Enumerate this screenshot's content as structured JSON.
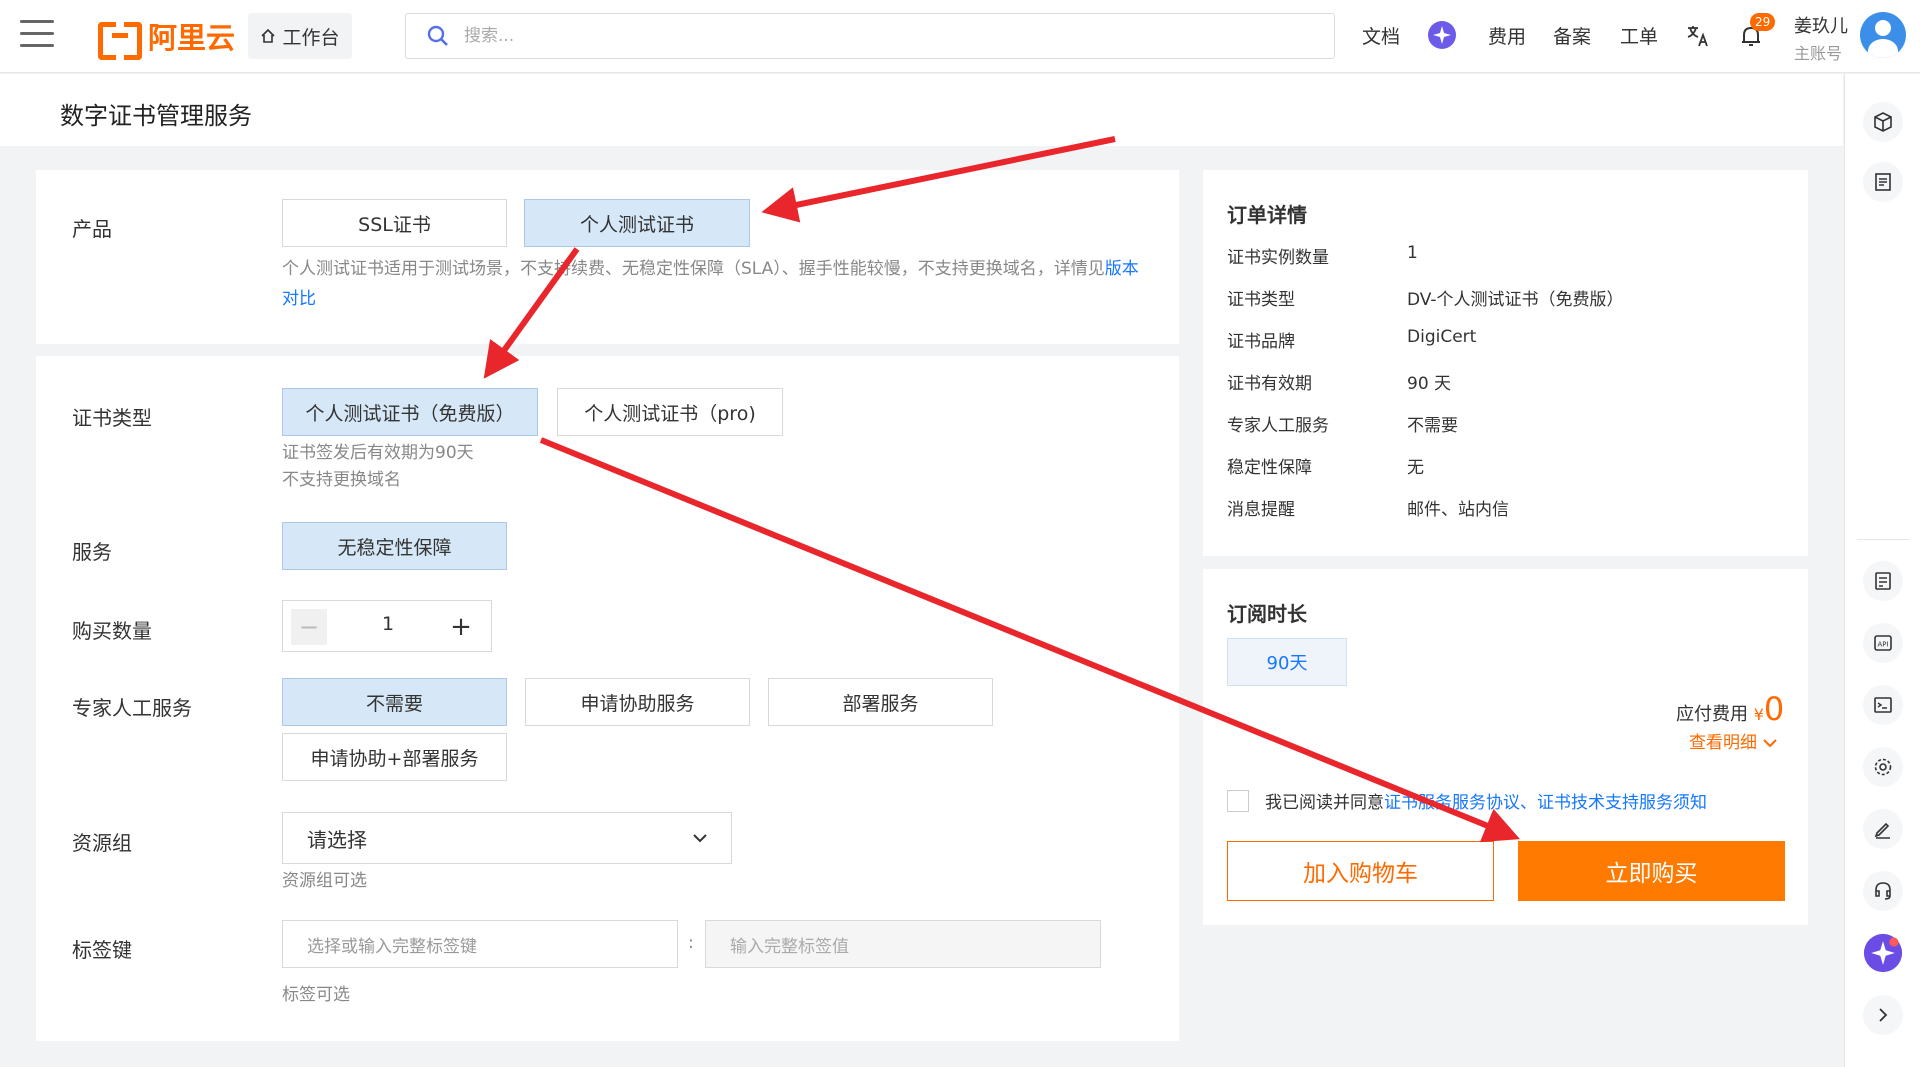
{
  "topbar": {
    "workbench": "工作台",
    "search_placeholder": "搜索...",
    "nav": [
      "文档",
      "费用",
      "备案",
      "工单"
    ],
    "notification_count": "29",
    "user_name": "姜玖儿",
    "user_role": "主账号"
  },
  "page_title": "数字证书管理服务",
  "product": {
    "label": "产品",
    "options": [
      "SSL证书",
      "个人测试证书"
    ],
    "selected": "个人测试证书",
    "hint_text": "个人测试证书适用于测试场景，不支持续费、无稳定性保障（SLA）、握手性能较慢，不支持更换域名，详情见",
    "hint_link": "版本对比"
  },
  "cert_type": {
    "label": "证书类型",
    "options": [
      "个人测试证书（免费版）",
      "个人测试证书（pro)"
    ],
    "selected": "个人测试证书（免费版）",
    "hint_line1": "证书签发后有效期为90天",
    "hint_line2": "不支持更换域名"
  },
  "service": {
    "label": "服务",
    "option": "无稳定性保障"
  },
  "quantity": {
    "label": "购买数量",
    "value": "1",
    "minus": "−",
    "plus": "+"
  },
  "expert": {
    "label": "专家人工服务",
    "options": [
      "不需要",
      "申请协助服务",
      "部署服务",
      "申请协助+部署服务"
    ],
    "selected": "不需要"
  },
  "resource_group": {
    "label": "资源组",
    "placeholder": "请选择",
    "hint": "资源组可选"
  },
  "tag": {
    "label": "标签键",
    "key_placeholder": "选择或输入完整标签键",
    "separator": ":",
    "value_placeholder": "输入完整标签值",
    "hint": "标签可选"
  },
  "order": {
    "title": "订单详情",
    "rows": [
      {
        "key": "证书实例数量",
        "value": "1"
      },
      {
        "key": "证书类型",
        "value": "DV-个人测试证书（免费版）"
      },
      {
        "key": "证书品牌",
        "value": "DigiCert"
      },
      {
        "key": "证书有效期",
        "value": "90 天"
      },
      {
        "key": "专家人工服务",
        "value": "不需要"
      },
      {
        "key": "稳定性保障",
        "value": "无"
      },
      {
        "key": "消息提醒",
        "value": "邮件、站内信"
      }
    ]
  },
  "subscription": {
    "title": "订阅时长",
    "duration": "90天",
    "fee_label": "应付费用",
    "currency": "¥",
    "amount": "0",
    "detail_link": "查看明细",
    "agree_text": "我已阅读并同意",
    "agree_links": "证书服务服务协议、证书技术支持服务须知",
    "cart_button": "加入购物车",
    "buy_button": "立即购买"
  },
  "colors": {
    "brand": "#ff6a00",
    "selected_bg": "#d6e8f7",
    "link": "#1677ff",
    "arrow": "#e8262b"
  }
}
